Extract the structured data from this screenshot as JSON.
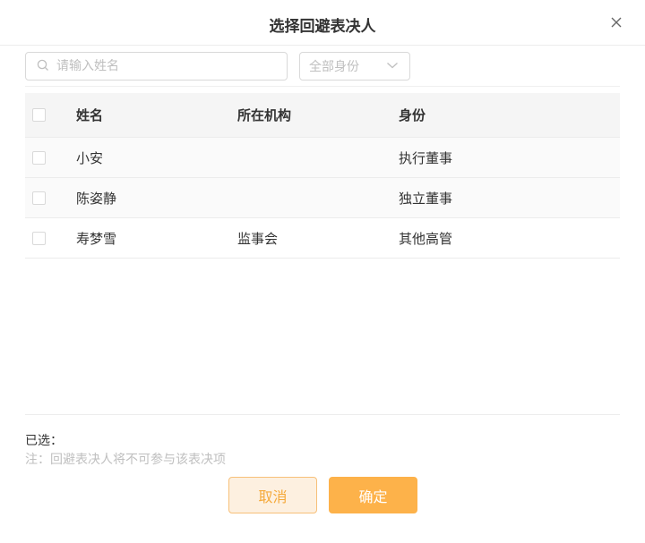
{
  "dialog": {
    "title": "选择回避表决人"
  },
  "filters": {
    "search_placeholder": "请输入姓名",
    "role_select_value": "全部身份"
  },
  "table": {
    "headers": {
      "name": "姓名",
      "org": "所在机构",
      "role": "身份"
    },
    "rows": [
      {
        "name": "小安",
        "org": "",
        "role": "执行董事"
      },
      {
        "name": "陈姿静",
        "org": "",
        "role": "独立董事"
      },
      {
        "name": "寿梦雪",
        "org": "监事会",
        "role": "其他高管"
      }
    ]
  },
  "footer": {
    "selected_label": "已选：",
    "note": "注：回避表决人将不可参与该表决项",
    "cancel_label": "取消",
    "confirm_label": "确定"
  },
  "colors": {
    "accent": "#fdb24a",
    "cancel_bg": "#fdf0e0",
    "cancel_text": "#f5a93a"
  },
  "icons": {
    "close": "close-icon",
    "search": "search-icon",
    "dropdown": "chevron-down-icon"
  }
}
